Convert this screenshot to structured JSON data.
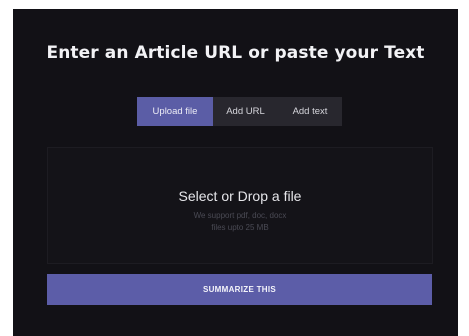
{
  "header": {
    "title": "Enter an Article URL or paste your Text"
  },
  "tabs": [
    {
      "label": "Upload file",
      "active": true
    },
    {
      "label": "Add URL",
      "active": false
    },
    {
      "label": "Add text",
      "active": false
    }
  ],
  "dropzone": {
    "title": "Select or Drop a file",
    "hint_line1": "We support pdf, doc, docx",
    "hint_line2": "files upto 25 MB"
  },
  "actions": {
    "submit_label": "SUMMARIZE THIS"
  },
  "colors": {
    "background": "#121116",
    "accent": "#5c5da8",
    "tab_bar": "#28272e",
    "text_primary": "#f2f2f5",
    "text_muted": "#4a4a54"
  }
}
